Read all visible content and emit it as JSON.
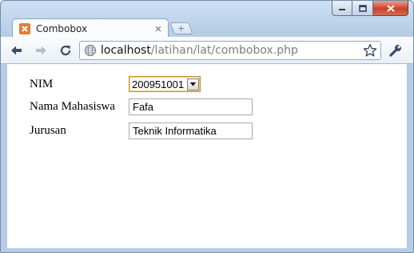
{
  "browser": {
    "tab_title": "Combobox",
    "url_host": "localhost",
    "url_path": "/latihan/lat/combobox.php"
  },
  "form": {
    "nim_label": "NIM",
    "nim_value": "200951001",
    "nama_label": "Nama Mahasiswa",
    "nama_value": "Fafa",
    "jurusan_label": "Jurusan",
    "jurusan_value": "Teknik Informatika"
  },
  "icons": {
    "favicon": "xampp-icon",
    "tab_close": "close-icon",
    "back": "back-arrow-icon",
    "forward": "forward-arrow-icon",
    "reload": "reload-icon",
    "page_info": "globe-icon",
    "bookmark": "star-icon",
    "settings": "wrench-icon",
    "dropdown": "chevron-down-icon"
  },
  "colors": {
    "window_frame": "#b7cde6",
    "favicon": "#e87b32",
    "close_button": "#c8432a",
    "select_focus": "#c08e2e"
  }
}
